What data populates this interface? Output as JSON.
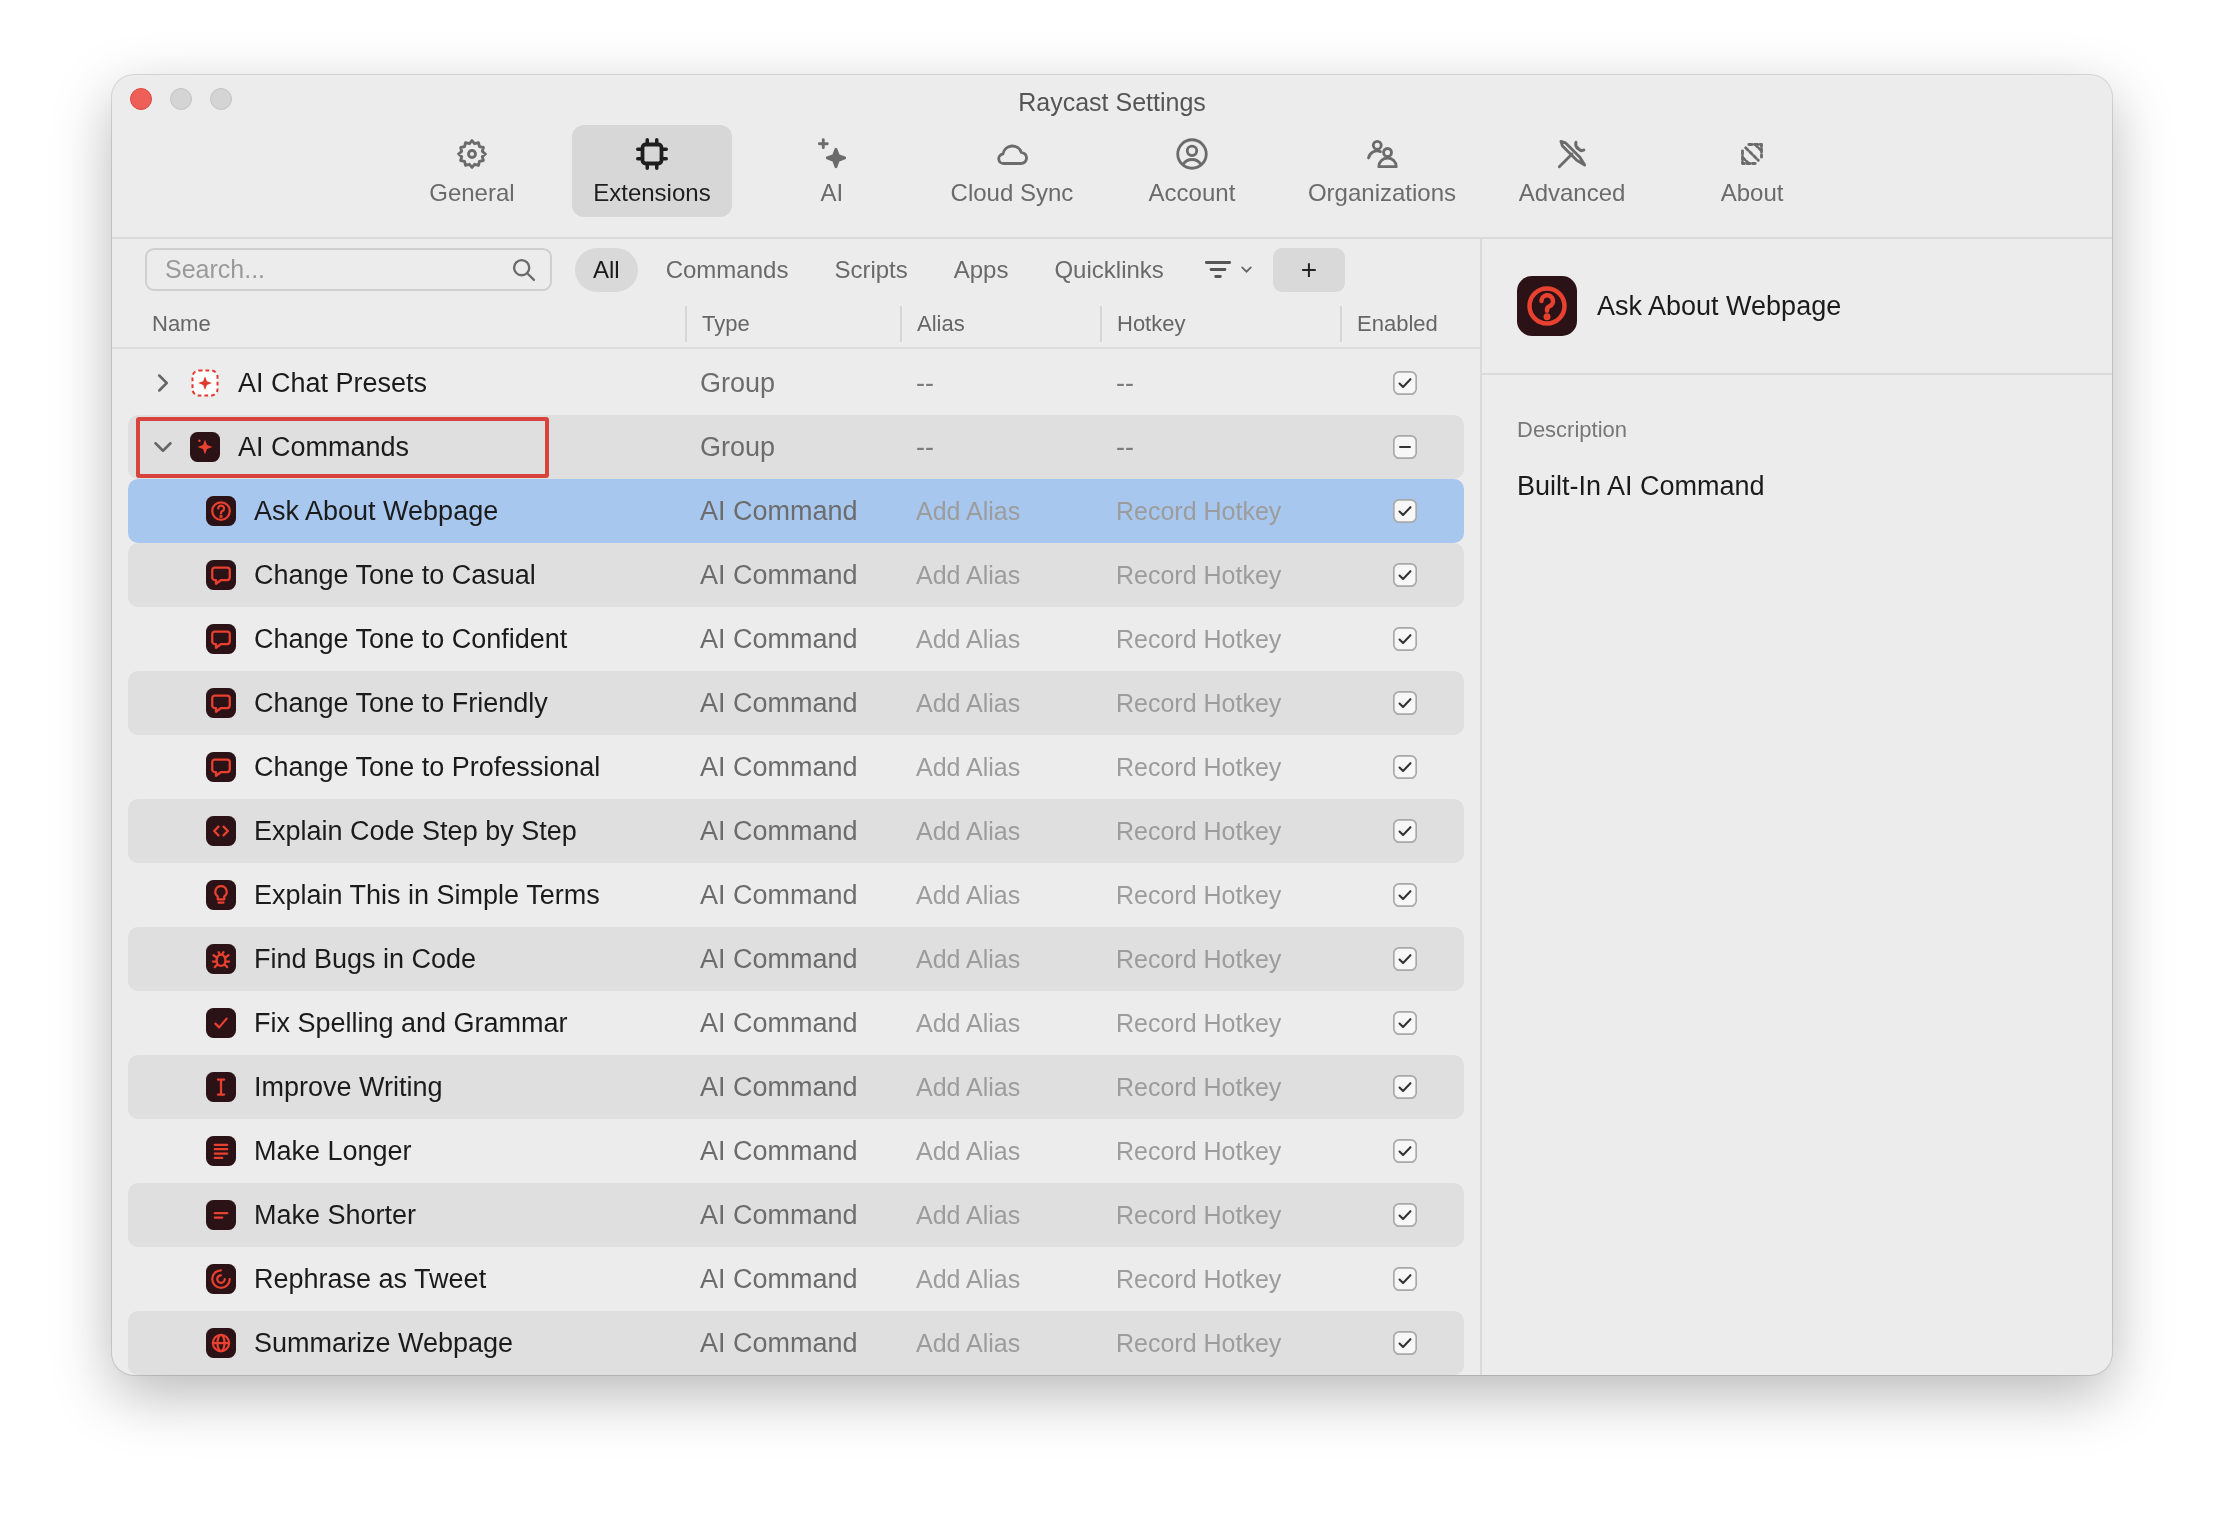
{
  "window": {
    "title": "Raycast Settings"
  },
  "toolbar": [
    {
      "label": "General",
      "selected": false
    },
    {
      "label": "Extensions",
      "selected": true
    },
    {
      "label": "AI",
      "selected": false
    },
    {
      "label": "Cloud Sync",
      "selected": false
    },
    {
      "label": "Account",
      "selected": false
    },
    {
      "label": "Organizations",
      "selected": false
    },
    {
      "label": "Advanced",
      "selected": false
    },
    {
      "label": "About",
      "selected": false
    }
  ],
  "filters": {
    "search": {
      "placeholder": "Search..."
    },
    "segments": [
      {
        "label": "All",
        "selected": true
      },
      {
        "label": "Commands",
        "selected": false
      },
      {
        "label": "Scripts",
        "selected": false
      },
      {
        "label": "Apps",
        "selected": false
      },
      {
        "label": "Quicklinks",
        "selected": false
      }
    ],
    "add_button": "+"
  },
  "table": {
    "columns": [
      "Name",
      "Type",
      "Alias",
      "Hotkey",
      "Enabled"
    ],
    "rows": [
      {
        "name": "AI Chat Presets",
        "type": "Group",
        "alias": "--",
        "hotkey": "--",
        "checked": true,
        "mixed": false,
        "expanded": false,
        "selected": false,
        "highlighted": false
      },
      {
        "name": "AI Commands",
        "type": "Group",
        "alias": "--",
        "hotkey": "--",
        "mixed": true,
        "expanded": true,
        "selected": false,
        "highlighted": true,
        "children": [
          {
            "name": "Ask About Webpage",
            "type": "AI Command",
            "alias": "Add Alias",
            "hotkey": "Record Hotkey",
            "checked": true,
            "selected": true
          },
          {
            "name": "Change Tone to Casual",
            "type": "AI Command",
            "alias": "Add Alias",
            "hotkey": "Record Hotkey",
            "checked": true,
            "selected": false
          },
          {
            "name": "Change Tone to Confident",
            "type": "AI Command",
            "alias": "Add Alias",
            "hotkey": "Record Hotkey",
            "checked": true,
            "selected": false
          },
          {
            "name": "Change Tone to Friendly",
            "type": "AI Command",
            "alias": "Add Alias",
            "hotkey": "Record Hotkey",
            "checked": true,
            "selected": false
          },
          {
            "name": "Change Tone to Professional",
            "type": "AI Command",
            "alias": "Add Alias",
            "hotkey": "Record Hotkey",
            "checked": true,
            "selected": false
          },
          {
            "name": "Explain Code Step by Step",
            "type": "AI Command",
            "alias": "Add Alias",
            "hotkey": "Record Hotkey",
            "checked": true,
            "selected": false
          },
          {
            "name": "Explain This in Simple Terms",
            "type": "AI Command",
            "alias": "Add Alias",
            "hotkey": "Record Hotkey",
            "checked": true,
            "selected": false
          },
          {
            "name": "Find Bugs in Code",
            "type": "AI Command",
            "alias": "Add Alias",
            "hotkey": "Record Hotkey",
            "checked": true,
            "selected": false
          },
          {
            "name": "Fix Spelling and Grammar",
            "type": "AI Command",
            "alias": "Add Alias",
            "hotkey": "Record Hotkey",
            "checked": true,
            "selected": false
          },
          {
            "name": "Improve Writing",
            "type": "AI Command",
            "alias": "Add Alias",
            "hotkey": "Record Hotkey",
            "checked": true,
            "selected": false
          },
          {
            "name": "Make Longer",
            "type": "AI Command",
            "alias": "Add Alias",
            "hotkey": "Record Hotkey",
            "checked": true,
            "selected": false
          },
          {
            "name": "Make Shorter",
            "type": "AI Command",
            "alias": "Add Alias",
            "hotkey": "Record Hotkey",
            "checked": true,
            "selected": false
          },
          {
            "name": "Rephrase as Tweet",
            "type": "AI Command",
            "alias": "Add Alias",
            "hotkey": "Record Hotkey",
            "checked": true,
            "selected": false
          },
          {
            "name": "Summarize Webpage",
            "type": "AI Command",
            "alias": "Add Alias",
            "hotkey": "Record Hotkey",
            "checked": true,
            "selected": false
          }
        ]
      }
    ]
  },
  "detail": {
    "title": "Ask About Webpage",
    "description_label": "Description",
    "description": "Built-In AI Command"
  }
}
